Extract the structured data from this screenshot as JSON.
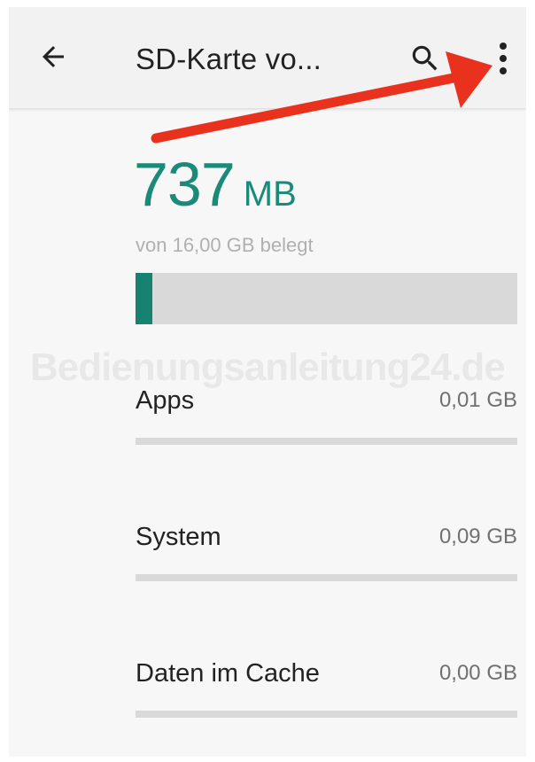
{
  "header": {
    "title": "SD-Karte vo...",
    "back_icon": "arrow-back-icon",
    "search_icon": "search-icon",
    "more_icon": "more-vert-icon"
  },
  "storage": {
    "used_amount": "737",
    "used_unit": "MB",
    "caption": "von 16,00 GB belegt",
    "used_fraction": 0.045,
    "accent_color": "#1b8a79"
  },
  "watermark": "Bedienungsanleitung24.de",
  "categories": [
    {
      "label": "Apps",
      "size": "0,01 GB",
      "fraction": 0.0
    },
    {
      "label": "System",
      "size": "0,09 GB",
      "fraction": 0.0
    },
    {
      "label": "Daten im Cache",
      "size": "0,00 GB",
      "fraction": 0.0
    }
  ],
  "annotation": {
    "arrow_color": "#e8321e"
  }
}
